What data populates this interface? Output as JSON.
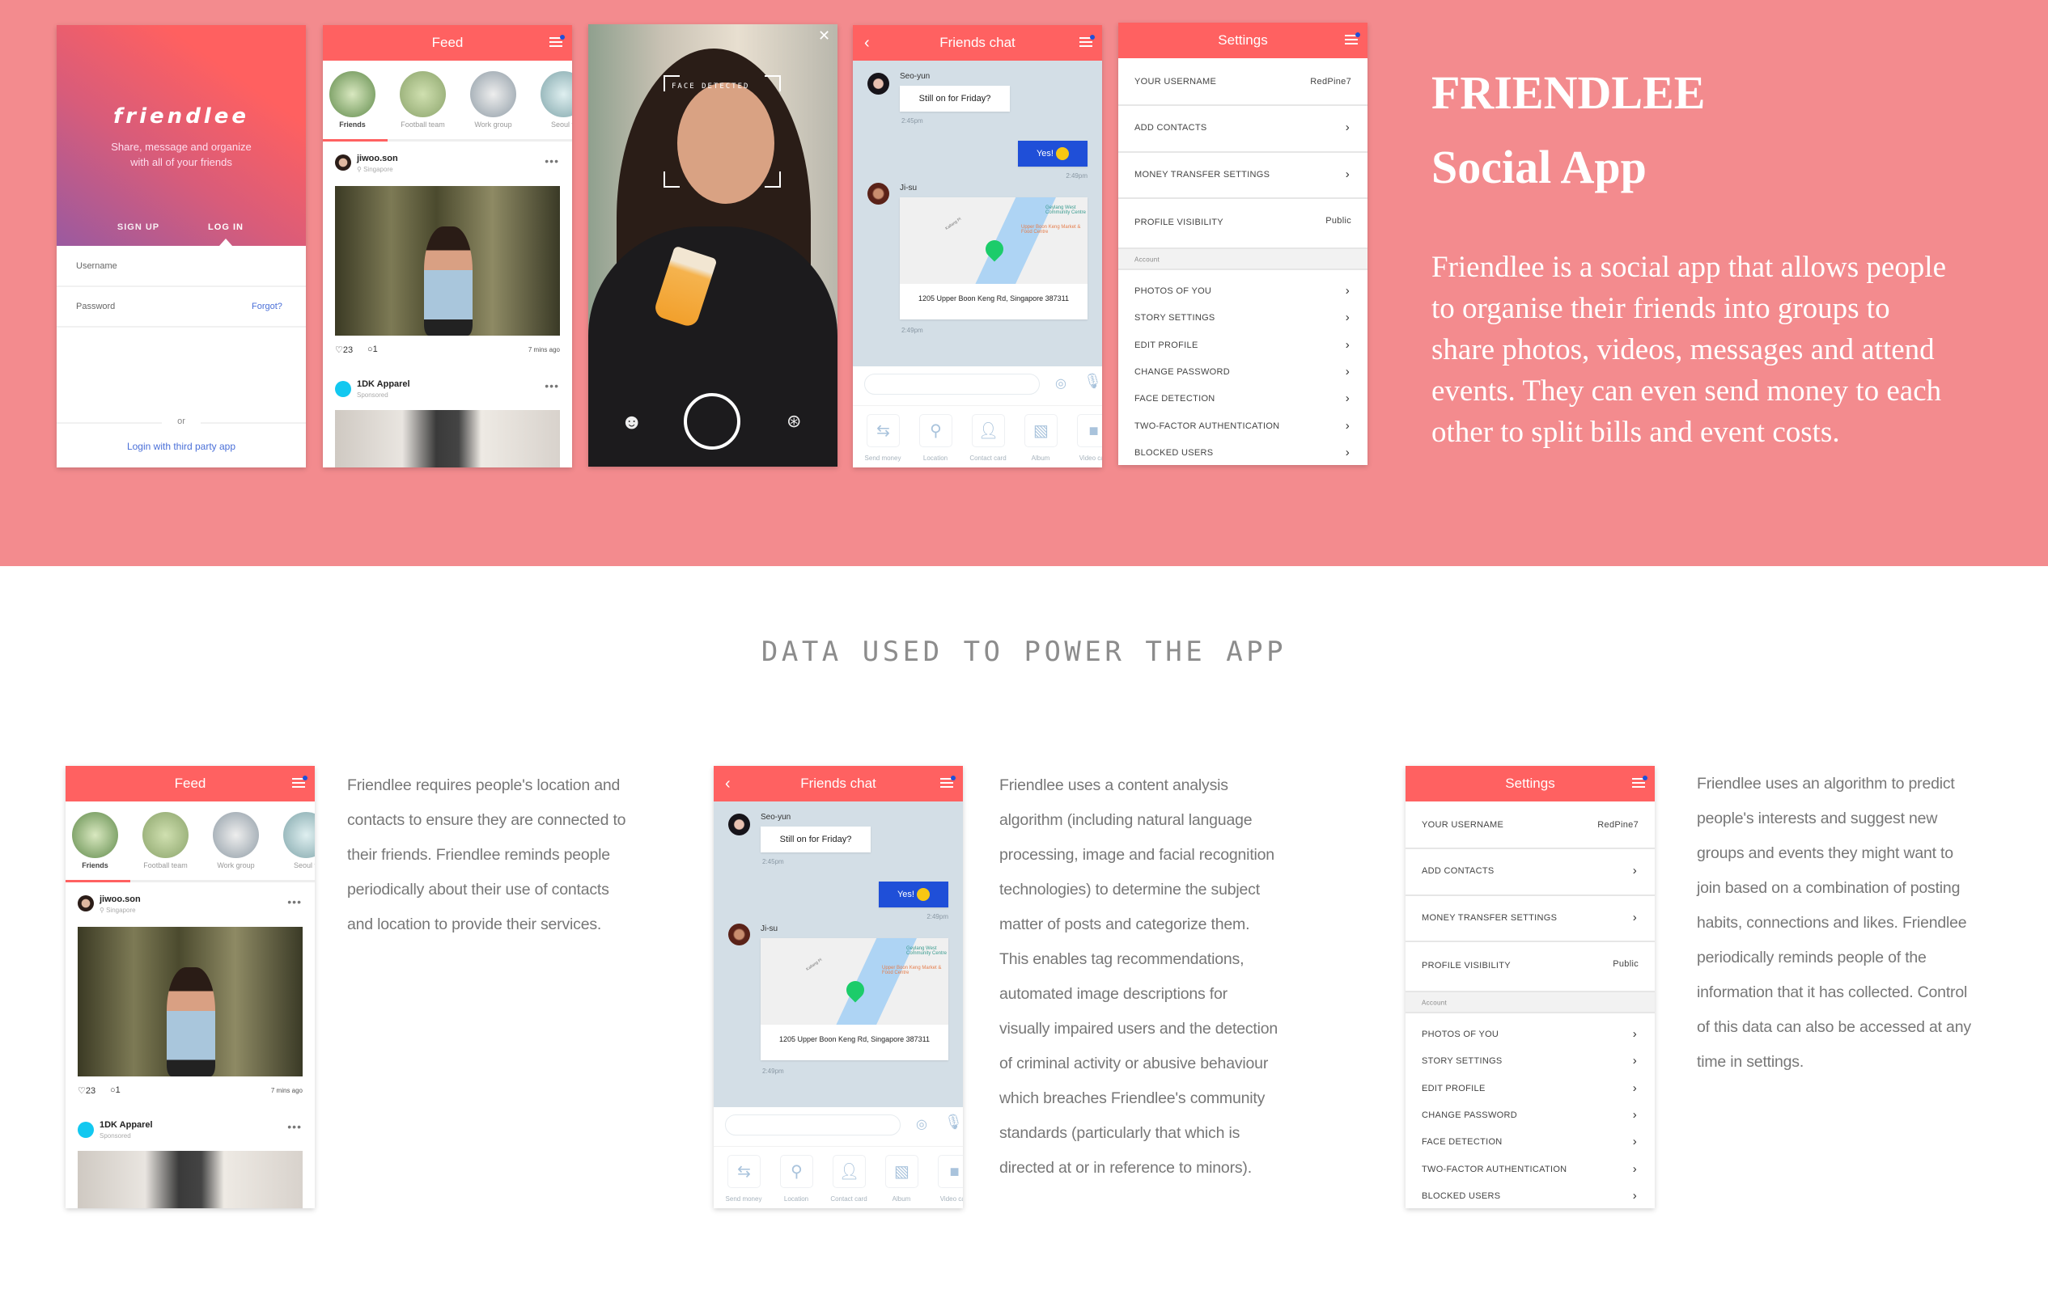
{
  "colors": {
    "band": "#f38b8e",
    "header": "#ff6161",
    "accent_blue": "#1f4fd8",
    "link": "#4a6fd8",
    "chat_bg": "#d3dee6"
  },
  "login": {
    "logo": "friendlee",
    "tagline": [
      "Share, message and organize",
      "with all of your friends"
    ],
    "signup": "SIGN UP",
    "login": "LOG IN",
    "username": "Username",
    "password": "Password",
    "forgot": "Forgot?",
    "or": "or",
    "third_party": "Login with third party app"
  },
  "feed": {
    "title": "Feed",
    "groups": [
      "Friends",
      "Football team",
      "Work group",
      "Seoul fr"
    ],
    "post1": {
      "user": "jiwoo.son",
      "location": "Singapore",
      "likes": "23",
      "comments": "1",
      "time": "7 mins ago"
    },
    "post2": {
      "user": "1DK Apparel",
      "subtitle": "Sponsored"
    }
  },
  "camera": {
    "label": "FACE DETECTED",
    "close_icon": "close-icon",
    "emoji_icon": "smiley-icon",
    "filter_icon": "filter-icon"
  },
  "chat": {
    "title": "Friends chat",
    "msg1": {
      "name": "Seo-yun",
      "text": "Still on for Friday?",
      "time": "2:45pm"
    },
    "msg2": {
      "text": "Yes!",
      "time": "2:49pm"
    },
    "msg3": {
      "name": "Ji-su",
      "address": "1205 Upper Boon Keng Rd, Singapore 387311",
      "time": "2:49pm",
      "map_labels": [
        "Geylang West Community Centre",
        "Upper Boon Keng Market & Food Centre",
        "Kallang Pl"
      ]
    },
    "tools": [
      "Send money",
      "Location",
      "Contact card",
      "Album",
      "Video call"
    ]
  },
  "settings": {
    "title": "Settings",
    "username_label": "YOUR USERNAME",
    "username_value": "RedPine7",
    "add_contacts": "ADD CONTACTS",
    "money": "MONEY TRANSFER SETTINGS",
    "visibility_label": "PROFILE VISIBILITY",
    "visibility_value": "Public",
    "section": "Account",
    "items": [
      "PHOTOS OF YOU",
      "STORY SETTINGS",
      "EDIT PROFILE",
      "CHANGE PASSWORD",
      "FACE DETECTION",
      "TWO-FACTOR AUTHENTICATION",
      "BLOCKED USERS"
    ]
  },
  "hero": {
    "title1": "FRIENDLEE",
    "title2": "Social App",
    "lines": [
      "Friendlee is a social app that allows people",
      "to organise their friends into groups to",
      "share photos, videos, messages and attend",
      "events. They can even send money to each",
      "other to split bills and event costs."
    ]
  },
  "section_heading": "DATA USED TO POWER THE APP",
  "columns": [
    {
      "lines": [
        "Friendlee requires people's location and",
        "contacts to ensure they are connected to",
        "their friends. Friendlee reminds people",
        "periodically about their use of contacts",
        "and location to provide their services."
      ]
    },
    {
      "lines": [
        "Friendlee uses a content analysis",
        "algorithm (including natural language",
        "processing, image and facial recognition",
        "technologies) to determine the subject",
        "matter of posts and categorize them.",
        "This enables tag recommendations,",
        "automated image descriptions for",
        "visually impaired users and the detection",
        "of criminal activity or abusive behaviour",
        "which breaches Friendlee's community",
        "standards (particularly that which is",
        "directed at or in reference to minors)."
      ]
    },
    {
      "lines": [
        "Friendlee uses an algorithm to predict",
        "people's interests and suggest new",
        "groups and events they might want to",
        "join based on a combination of posting",
        "habits, connections and likes. Friendlee",
        "periodically reminds people of the",
        "information that it has collected. Control",
        "of this data can also be accessed at any",
        "time in settings."
      ]
    }
  ]
}
